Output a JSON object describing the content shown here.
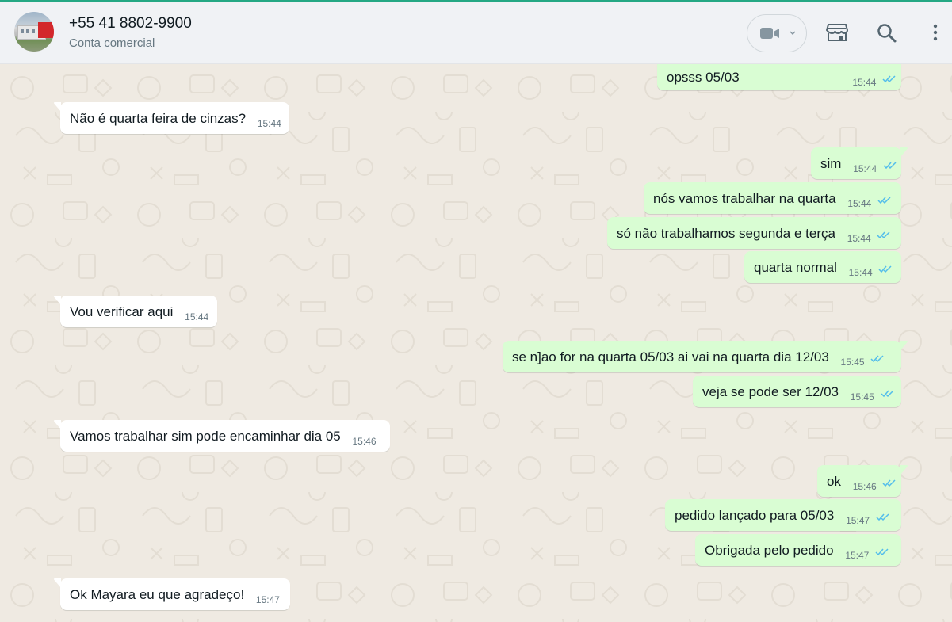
{
  "contact": {
    "phone": "+55 41 8802-9900",
    "subtitle": "Conta comercial",
    "avatar": "business-photo"
  },
  "header_icons": [
    "video-call-icon",
    "chevron-down-icon",
    "catalog-store-icon",
    "search-icon",
    "menu-dots-icon"
  ],
  "colors": {
    "outgoing_bubble": "#d9fdd3",
    "incoming_bubble": "#ffffff",
    "read_ticks": "#53bdeb",
    "background": "#efeae2",
    "header": "#f0f2f5"
  },
  "messages": [
    {
      "dir": "out",
      "text": "opsss 05/03",
      "time": "15:44",
      "status": "read"
    },
    {
      "dir": "in",
      "text": "Não é quarta feira de cinzas?",
      "time": "15:44"
    },
    {
      "dir": "out",
      "text": "sim",
      "time": "15:44",
      "status": "read"
    },
    {
      "dir": "out",
      "text": "nós vamos trabalhar na quarta",
      "time": "15:44",
      "status": "read"
    },
    {
      "dir": "out",
      "text": "só não trabalhamos segunda e terça",
      "time": "15:44",
      "status": "read"
    },
    {
      "dir": "out",
      "text": "quarta normal",
      "time": "15:44",
      "status": "read"
    },
    {
      "dir": "in",
      "text": "Vou verificar aqui",
      "time": "15:44"
    },
    {
      "dir": "out",
      "text": "se n]ao for na quarta 05/03 ai vai na quarta dia 12/03",
      "time": "15:45",
      "status": "read"
    },
    {
      "dir": "out",
      "text": "veja se pode ser 12/03",
      "time": "15:45",
      "status": "read"
    },
    {
      "dir": "in",
      "text": "Vamos trabalhar sim pode encaminhar dia 05",
      "time": "15:46"
    },
    {
      "dir": "out",
      "text": "ok",
      "time": "15:46",
      "status": "read"
    },
    {
      "dir": "out",
      "text": "pedido lançado para 05/03",
      "time": "15:47",
      "status": "read"
    },
    {
      "dir": "out",
      "text": "Obrigada pelo pedido",
      "time": "15:47",
      "status": "read"
    },
    {
      "dir": "in",
      "text": "Ok Mayara eu que agradeço!",
      "time": "15:47"
    }
  ]
}
